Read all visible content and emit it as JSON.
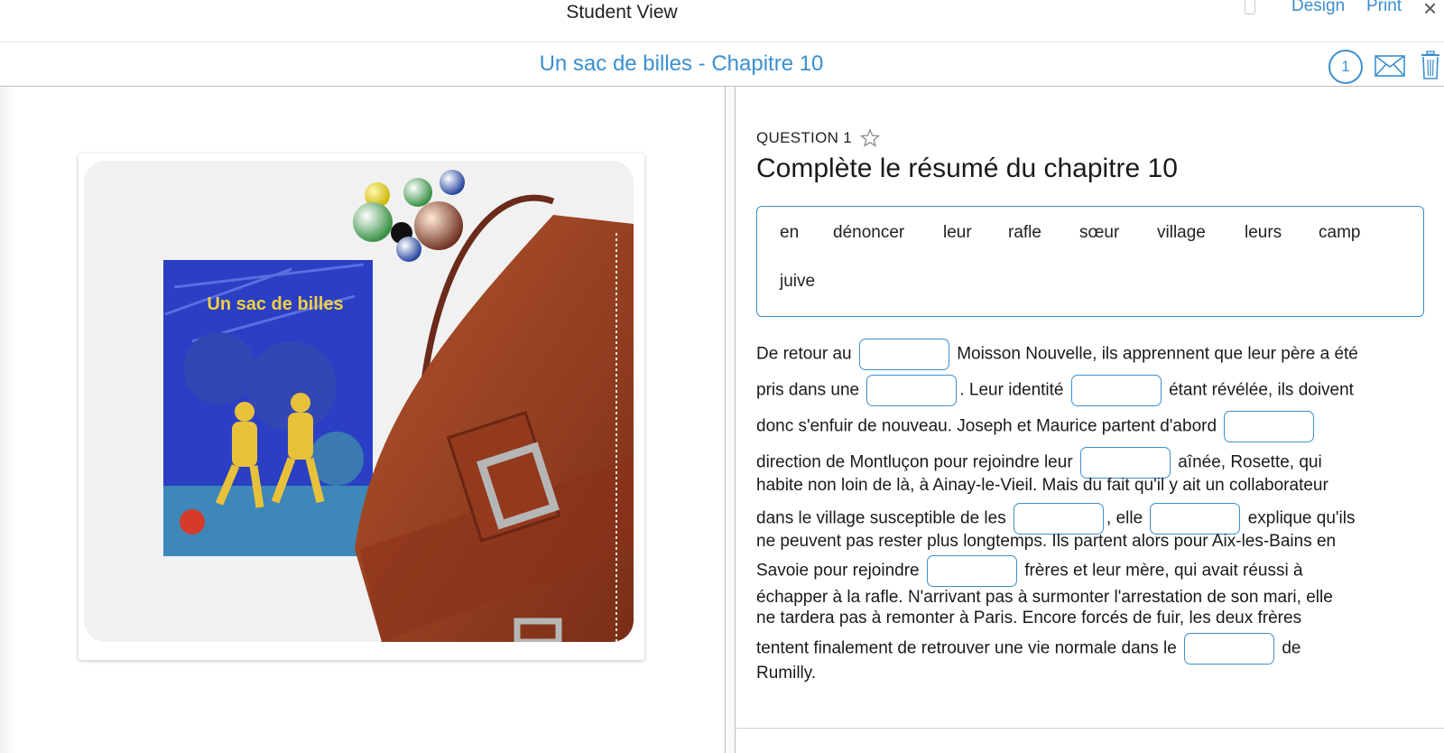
{
  "topbar": {
    "title": "Student View",
    "design_label": "Design",
    "print_label": "Print",
    "close_glyph": "×"
  },
  "assignment": {
    "title": "Un sac de billes - Chapitre 10",
    "badge_count": "1"
  },
  "image": {
    "book_title": "Un sac de billes"
  },
  "question": {
    "label": "QUESTION 1",
    "heading": "Complète le résumé du chapitre 10",
    "word_bank": [
      "en",
      "dénoncer",
      "leur",
      "rafle",
      "sœur",
      "village",
      "leurs",
      "camp",
      "juive"
    ],
    "passage": {
      "l1a": "De retour au",
      "l1b": "Moisson Nouvelle, ils apprennent que leur père a été",
      "l2a": "pris dans une",
      "l2b": ". Leur identité",
      "l2c": "étant révélée, ils doivent",
      "l3a": "donc s'enfuir de nouveau. Joseph et Maurice partent d'abord",
      "l4a": "direction de Montluçon pour rejoindre leur",
      "l4b": "aînée, Rosette, qui",
      "l5": "habite non loin de là, à Ainay-le-Vieil. Mais du fait qu'il y ait un collaborateur",
      "l6a": "dans le village susceptible de les",
      "l6b": ", elle",
      "l6c": "explique qu'ils",
      "l7": "ne peuvent pas rester plus longtemps. Ils partent alors pour Aix-les-Bains en",
      "l8a": "Savoie pour rejoindre",
      "l8b": "frères et leur mère, qui avait réussi à",
      "l9": "échapper à la rafle. N'arrivant pas à surmonter l'arrestation de son mari, elle",
      "l10": "ne tardera pas à remonter à Paris. Encore forcés de fuir, les deux frères",
      "l11a": "tentent finalement de retrouver une vie normale dans le",
      "l11b": "de",
      "l12": "Rumilly."
    }
  },
  "icons": {
    "mail": "mail-icon",
    "trash": "trash-icon",
    "star": "star-outline-icon",
    "phone": "mobile-preview-icon"
  },
  "colors": {
    "accent": "#3a8fd0",
    "book_blue": "#2a3fc4",
    "bag_brown": "#8e3a20"
  }
}
